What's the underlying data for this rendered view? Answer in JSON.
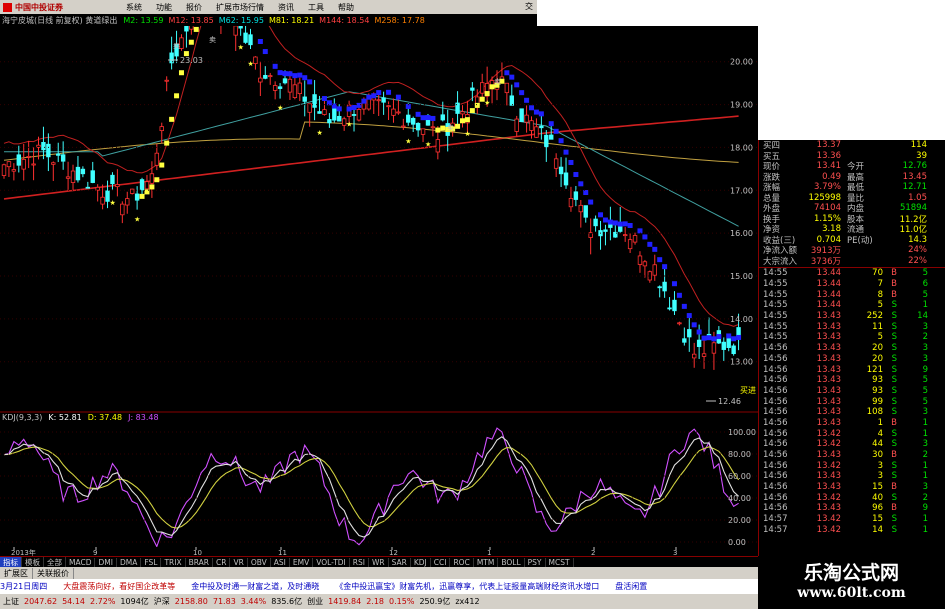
{
  "menubar": {
    "logo_text": "中国中投证券",
    "items": [
      "系统",
      "功能",
      "报价",
      "扩展市场行情",
      "资讯",
      "工具",
      "帮助"
    ],
    "close_glyph": "交"
  },
  "indicator_bar": {
    "title": "海宁皮城(日线 前复权) 黄道绿出",
    "items": [
      {
        "text": "M2: 13.59",
        "color": "#00e000"
      },
      {
        "text": "M12: 13.85",
        "color": "#ff4040"
      },
      {
        "text": "M62: 15.95",
        "color": "#00e0e0"
      },
      {
        "text": "M81: 18.21",
        "color": "#ffff00"
      },
      {
        "text": "M144: 18.54",
        "color": "#ff4040"
      },
      {
        "text": "M258: 17.78",
        "color": "#ff8000"
      }
    ]
  },
  "price_axis": [
    "20.00",
    "19.00",
    "18.00",
    "17.00",
    "16.00",
    "15.00",
    "14.00",
    "13.00"
  ],
  "annotations": {
    "high_label": "23.03",
    "low_label": "12.46",
    "sell_label": "卖",
    "buy_label": "买进"
  },
  "kdj": {
    "title": "KDJ(9,3,3)",
    "k": "K: 52.81",
    "d": "D: 37.48",
    "j": "J: 83.48",
    "axis": [
      "100.00",
      "80.00",
      "60.00",
      "40.00",
      "20.00",
      "0.00"
    ]
  },
  "date_axis": [
    "2013年",
    "9",
    "10",
    "11",
    "12",
    "1",
    "2",
    "3"
  ],
  "quote": {
    "rows": [
      {
        "l1": "买四",
        "v1": "13.37",
        "l2": "",
        "v2": "114",
        "c1": "#ff5050",
        "c2": "#ffff00"
      },
      {
        "l1": "买五",
        "v1": "13.36",
        "l2": "",
        "v2": "39",
        "c1": "#ff5050",
        "c2": "#ffff00"
      },
      {
        "l1": "现价",
        "v1": "13.41",
        "l2": "今开",
        "v2": "12.76",
        "c1": "#ff5050",
        "c2": "#00e000"
      },
      {
        "l1": "涨跌",
        "v1": "0.49",
        "l2": "最高",
        "v2": "13.45",
        "c1": "#ff5050",
        "c2": "#ff5050"
      },
      {
        "l1": "涨幅",
        "v1": "3.79%",
        "l2": "最低",
        "v2": "12.71",
        "c1": "#ff5050",
        "c2": "#00e000"
      },
      {
        "l1": "总量",
        "v1": "125998",
        "l2": "量比",
        "v2": "1.05",
        "c1": "#ffff00",
        "c2": "#ff5050"
      },
      {
        "l1": "外盘",
        "v1": "74104",
        "l2": "内盘",
        "v2": "51894",
        "c1": "#ff5050",
        "c2": "#00e000"
      },
      {
        "l1": "换手",
        "v1": "1.15%",
        "l2": "股本",
        "v2": "11.2亿",
        "c1": "#ffff00",
        "c2": "#ffff00"
      },
      {
        "l1": "净资",
        "v1": "3.18",
        "l2": "流通",
        "v2": "11.0亿",
        "c1": "#ffff00",
        "c2": "#ffff00"
      },
      {
        "l1": "收益(三)",
        "v1": "0.704",
        "l2": "PE(动)",
        "v2": "14.3",
        "c1": "#ffff00",
        "c2": "#ffff00"
      },
      {
        "l1": "净流入额",
        "v1": "3913万",
        "l2": "",
        "v2": "24%",
        "c1": "#ff5050",
        "c2": "#ff5050"
      },
      {
        "l1": "大宗流入",
        "v1": "3736万",
        "l2": "",
        "v2": "22%",
        "c1": "#ff5050",
        "c2": "#ff5050"
      }
    ],
    "ticks": [
      {
        "t": "14:55",
        "p": "13.44",
        "v": "70",
        "d": "B",
        "n": "5"
      },
      {
        "t": "14:55",
        "p": "13.44",
        "v": "7",
        "d": "B",
        "n": "6"
      },
      {
        "t": "14:55",
        "p": "13.44",
        "v": "8",
        "d": "B",
        "n": "5"
      },
      {
        "t": "14:55",
        "p": "13.44",
        "v": "5",
        "d": "S",
        "n": "1"
      },
      {
        "t": "14:55",
        "p": "13.43",
        "v": "252",
        "d": "S",
        "n": "14"
      },
      {
        "t": "14:55",
        "p": "13.43",
        "v": "11",
        "d": "S",
        "n": "3"
      },
      {
        "t": "14:55",
        "p": "13.43",
        "v": "5",
        "d": "S",
        "n": "2"
      },
      {
        "t": "14:56",
        "p": "13.43",
        "v": "20",
        "d": "S",
        "n": "3"
      },
      {
        "t": "14:56",
        "p": "13.43",
        "v": "20",
        "d": "S",
        "n": "3"
      },
      {
        "t": "14:56",
        "p": "13.43",
        "v": "121",
        "d": "S",
        "n": "9"
      },
      {
        "t": "14:56",
        "p": "13.43",
        "v": "93",
        "d": "S",
        "n": "5"
      },
      {
        "t": "14:56",
        "p": "13.43",
        "v": "93",
        "d": "S",
        "n": "5"
      },
      {
        "t": "14:56",
        "p": "13.43",
        "v": "99",
        "d": "S",
        "n": "5"
      },
      {
        "t": "14:56",
        "p": "13.43",
        "v": "108",
        "d": "S",
        "n": "3"
      },
      {
        "t": "14:56",
        "p": "13.43",
        "v": "1",
        "d": "B",
        "n": "1"
      },
      {
        "t": "14:56",
        "p": "13.42",
        "v": "4",
        "d": "S",
        "n": "1"
      },
      {
        "t": "14:56",
        "p": "13.42",
        "v": "44",
        "d": "S",
        "n": "3"
      },
      {
        "t": "14:56",
        "p": "13.43",
        "v": "30",
        "d": "B",
        "n": "2"
      },
      {
        "t": "14:56",
        "p": "13.42",
        "v": "3",
        "d": "S",
        "n": "1"
      },
      {
        "t": "14:56",
        "p": "13.43",
        "v": "3",
        "d": "S",
        "n": "1"
      },
      {
        "t": "14:56",
        "p": "13.43",
        "v": "15",
        "d": "B",
        "n": "3"
      },
      {
        "t": "14:56",
        "p": "13.42",
        "v": "40",
        "d": "S",
        "n": "2"
      },
      {
        "t": "14:56",
        "p": "13.43",
        "v": "96",
        "d": "B",
        "n": "9"
      },
      {
        "t": "14:57",
        "p": "13.42",
        "v": "15",
        "d": "S",
        "n": "1"
      },
      {
        "t": "14:57",
        "p": "13.42",
        "v": "14",
        "d": "S",
        "n": "1"
      }
    ]
  },
  "tabs": [
    "指标",
    "模板",
    "全部",
    "MACD",
    "DMI",
    "DMA",
    "FSL",
    "TRIX",
    "BRAR",
    "CR",
    "VR",
    "OBV",
    "ASI",
    "EMV",
    "VOL-TDI",
    "RSI",
    "WR",
    "SAR",
    "KDJ",
    "CCI",
    "ROC",
    "MTM",
    "BOLL",
    "PSY",
    "MCST"
  ],
  "active_tab": "指标",
  "tabs2": [
    "扩展区",
    "关联报价"
  ],
  "news": [
    {
      "text": "3月21日周四",
      "color": "#0000c0"
    },
    {
      "text": "大盘震荡向好，看好国企改革等",
      "color": "#c00000"
    },
    {
      "text": "金中投及时通一财富之道，及时通晓",
      "color": "#0000c0"
    },
    {
      "text": "《金中投迅赢宝》财富先机，迅赢尊享，代表上证报量高端财经资讯水增口",
      "color": "#0000c0"
    },
    {
      "text": "盘活闲置",
      "color": "#0000c0"
    }
  ],
  "status": [
    {
      "text": "上证",
      "color": "#000"
    },
    {
      "text": "2047.62",
      "color": "#c00000"
    },
    {
      "text": "54.14",
      "color": "#c00000"
    },
    {
      "text": "2.72%",
      "color": "#c00000"
    },
    {
      "text": "1094亿",
      "color": "#000"
    },
    {
      "text": "沪深",
      "color": "#000"
    },
    {
      "text": "2158.80",
      "color": "#c00000"
    },
    {
      "text": "71.83",
      "color": "#c00000"
    },
    {
      "text": "3.44%",
      "color": "#c00000"
    },
    {
      "text": "835.6亿",
      "color": "#000"
    },
    {
      "text": "创业",
      "color": "#000"
    },
    {
      "text": "1419.84",
      "color": "#c00000"
    },
    {
      "text": "2.18",
      "color": "#c00000"
    },
    {
      "text": "0.15%",
      "color": "#c00000"
    },
    {
      "text": "250.9亿",
      "color": "#000"
    },
    {
      "text": "zx412",
      "color": "#000"
    }
  ],
  "watermark": {
    "line1": "乐淘公式网",
    "line2": "www.60lt.com"
  }
}
